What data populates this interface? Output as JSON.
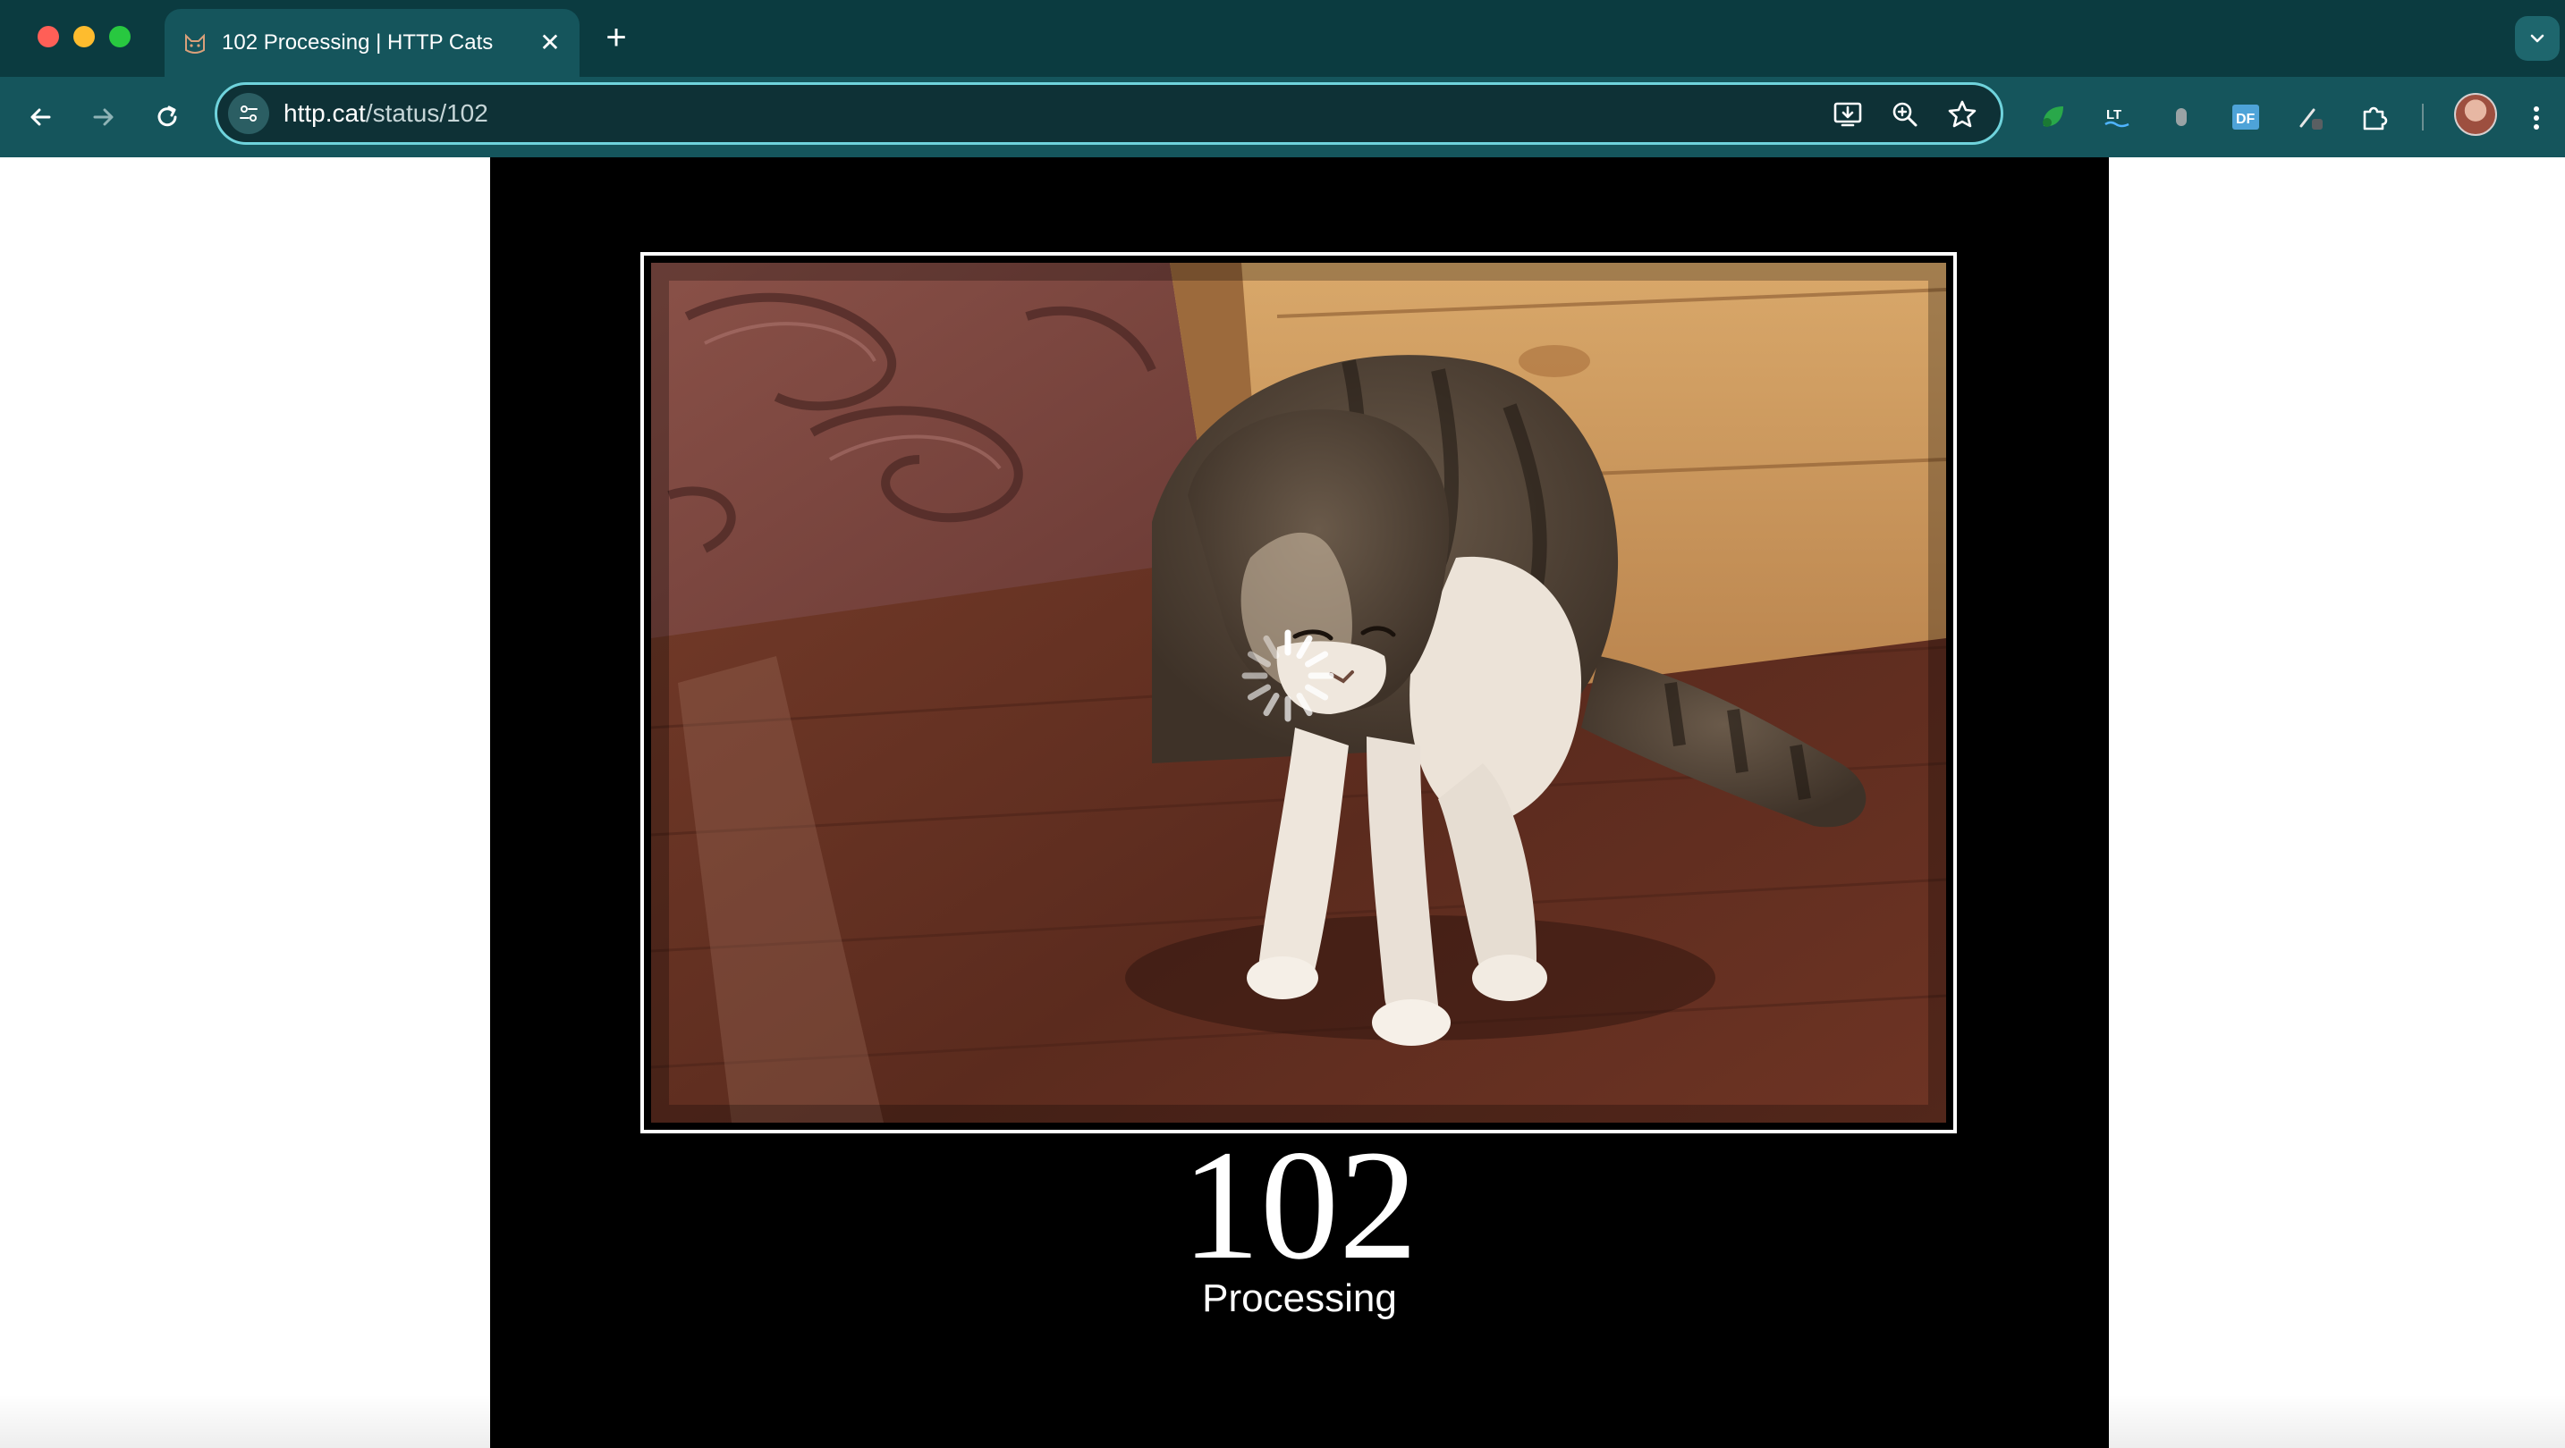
{
  "browser": {
    "tab": {
      "title": "102 Processing | HTTP Cats",
      "favicon": "cat-icon",
      "close_icon": "close-icon"
    },
    "new_tab_icon": "plus-icon",
    "tab_search_icon": "chevron-down-icon",
    "nav": {
      "back_icon": "arrow-left-icon",
      "forward_icon": "arrow-right-icon",
      "reload_icon": "reload-icon"
    },
    "address_bar": {
      "host": "http.cat",
      "path": "/status/102",
      "site_info_icon": "tune-icon",
      "actions": [
        "install-app-icon",
        "zoom-icon",
        "bookmark-star-icon"
      ]
    },
    "extensions": [
      "green-leaf-extension-icon",
      "translate-extension-icon",
      "mouse-extension-icon",
      "df-extension-icon",
      "eyedropper-extension-icon",
      "puzzle-icon"
    ],
    "avatar": "profile-avatar",
    "menu_icon": "kebab-menu-icon"
  },
  "page": {
    "image": {
      "subject": "cat-photo",
      "overlay_icon": "loading-spinner-icon"
    },
    "status_code": "102",
    "status_text": "Processing"
  },
  "colors": {
    "tab_strip": "#0b3b40",
    "toolbar": "#15555c",
    "omnibox_border": "#6fd3dc",
    "poster_background": "#000000",
    "page_background": "#ffffff"
  }
}
